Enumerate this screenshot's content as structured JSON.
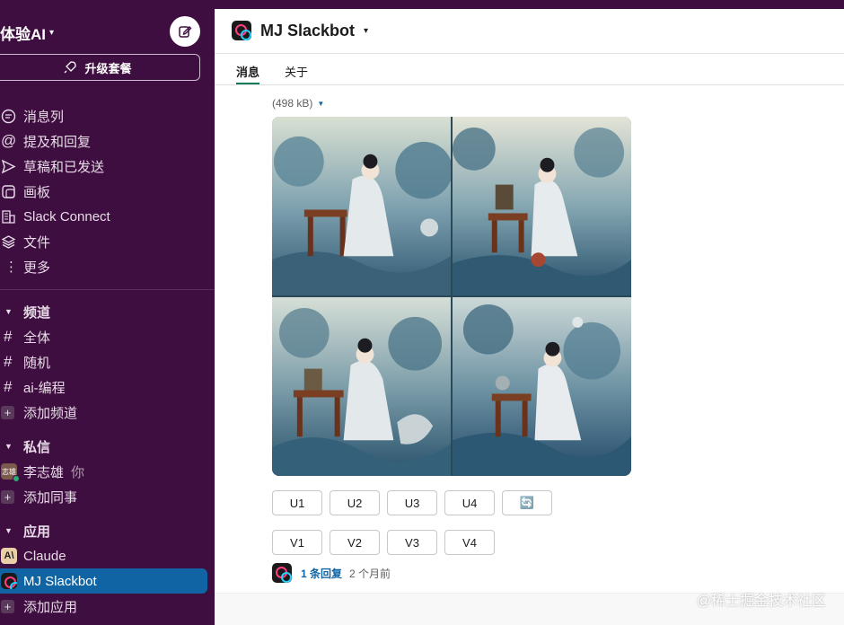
{
  "workspace": {
    "name": "体验AI",
    "upgrade_label": "升级套餐"
  },
  "nav": [
    {
      "icon": "threads-icon",
      "label": "消息列"
    },
    {
      "icon": "at-icon",
      "label": "提及和回复"
    },
    {
      "icon": "send-icon",
      "label": "草稿和已发送"
    },
    {
      "icon": "canvas-icon",
      "label": "画板"
    },
    {
      "icon": "building-icon",
      "label": "Slack Connect"
    },
    {
      "icon": "layers-icon",
      "label": "文件"
    },
    {
      "icon": "more-icon",
      "label": "更多"
    }
  ],
  "channels": {
    "header": "频道",
    "items": [
      "全体",
      "随机",
      "ai-编程"
    ],
    "add_label": "添加频道"
  },
  "dms": {
    "header": "私信",
    "user": {
      "avatar_text": "志雄",
      "name": "李志雄",
      "you": "你"
    },
    "add_label": "添加同事"
  },
  "apps": {
    "header": "应用",
    "items": [
      {
        "name": "Claude",
        "logo_text": "A\\"
      },
      {
        "name": "MJ Slackbot"
      }
    ],
    "add_label": "添加应用"
  },
  "channel": {
    "title": "MJ Slackbot",
    "tabs": [
      "消息",
      "关于"
    ]
  },
  "message": {
    "file_size": "(498 kB)",
    "upscale_buttons": [
      "U1",
      "U2",
      "U3",
      "U4"
    ],
    "refresh_icon": "🔄",
    "variation_buttons": [
      "V1",
      "V2",
      "V3",
      "V4"
    ],
    "replies": "1 条回复",
    "time": "2 个月前"
  },
  "watermark": "@稀土掘金技术社区",
  "colors": {
    "sidebar": "#3f0e40",
    "active": "#1164a3",
    "link": "#1264a3"
  }
}
